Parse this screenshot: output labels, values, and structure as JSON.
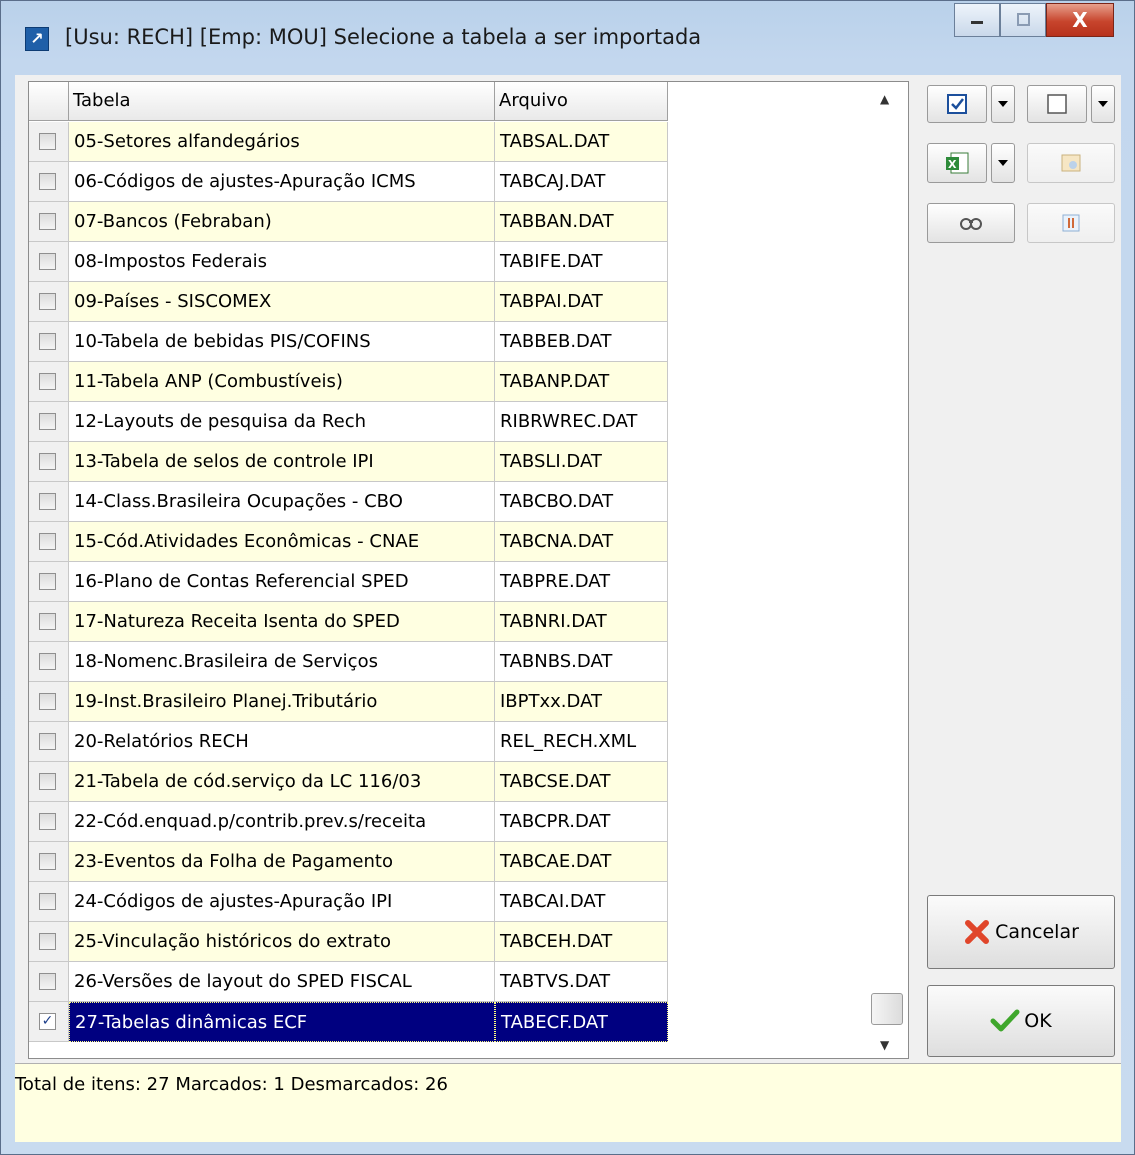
{
  "window": {
    "title": "[Usu: RECH] [Emp: MOU] Selecione a tabela a ser importada",
    "close_glyph": "X"
  },
  "table": {
    "columns": [
      "Tabela",
      "Arquivo"
    ],
    "rows": [
      {
        "checked": false,
        "tabela": "05-Setores alfandegários",
        "arquivo": "TABSAL.DAT"
      },
      {
        "checked": false,
        "tabela": "06-Códigos de ajustes-Apuração ICMS",
        "arquivo": "TABCAJ.DAT"
      },
      {
        "checked": false,
        "tabela": "07-Bancos (Febraban)",
        "arquivo": "TABBAN.DAT"
      },
      {
        "checked": false,
        "tabela": "08-Impostos Federais",
        "arquivo": "TABIFE.DAT"
      },
      {
        "checked": false,
        "tabela": "09-Países - SISCOMEX",
        "arquivo": "TABPAI.DAT"
      },
      {
        "checked": false,
        "tabela": "10-Tabela de bebidas PIS/COFINS",
        "arquivo": "TABBEB.DAT"
      },
      {
        "checked": false,
        "tabela": "11-Tabela ANP (Combustíveis)",
        "arquivo": "TABANP.DAT"
      },
      {
        "checked": false,
        "tabela": "12-Layouts de pesquisa da Rech",
        "arquivo": "RIBRWREC.DAT"
      },
      {
        "checked": false,
        "tabela": "13-Tabela de selos de controle IPI",
        "arquivo": "TABSLI.DAT"
      },
      {
        "checked": false,
        "tabela": "14-Class.Brasileira Ocupações - CBO",
        "arquivo": "TABCBO.DAT"
      },
      {
        "checked": false,
        "tabela": "15-Cód.Atividades Econômicas - CNAE",
        "arquivo": "TABCNA.DAT"
      },
      {
        "checked": false,
        "tabela": "16-Plano de Contas Referencial SPED",
        "arquivo": "TABPRE.DAT"
      },
      {
        "checked": false,
        "tabela": "17-Natureza Receita Isenta do SPED",
        "arquivo": "TABNRI.DAT"
      },
      {
        "checked": false,
        "tabela": "18-Nomenc.Brasileira de Serviços",
        "arquivo": "TABNBS.DAT"
      },
      {
        "checked": false,
        "tabela": "19-Inst.Brasileiro Planej.Tributário",
        "arquivo": "IBPTxx.DAT"
      },
      {
        "checked": false,
        "tabela": "20-Relatórios RECH",
        "arquivo": "REL_RECH.XML"
      },
      {
        "checked": false,
        "tabela": "21-Tabela de cód.serviço da LC 116/03",
        "arquivo": "TABCSE.DAT"
      },
      {
        "checked": false,
        "tabela": "22-Cód.enquad.p/contrib.prev.s/receita",
        "arquivo": "TABCPR.DAT"
      },
      {
        "checked": false,
        "tabela": "23-Eventos da Folha de Pagamento",
        "arquivo": "TABCAE.DAT"
      },
      {
        "checked": false,
        "tabela": "24-Códigos de ajustes-Apuração IPI",
        "arquivo": "TABCAI.DAT"
      },
      {
        "checked": false,
        "tabela": "25-Vinculação históricos do extrato",
        "arquivo": "TABCEH.DAT"
      },
      {
        "checked": false,
        "tabela": "26-Versões de layout do SPED FISCAL",
        "arquivo": "TABTVS.DAT"
      },
      {
        "checked": true,
        "tabela": "27-Tabelas dinâmicas ECF",
        "arquivo": "TABECF.DAT"
      }
    ]
  },
  "status": {
    "text": "Total de itens: 27 Marcados: 1 Desmarcados: 26"
  },
  "buttons": {
    "cancel_label": "Cancelar",
    "ok_label": "OK"
  },
  "icons": {
    "check_all": "checkbox-checked-icon",
    "uncheck_all": "checkbox-empty-icon",
    "excel": "excel-icon",
    "find": "binoculars-icon",
    "cancel": "red-x-icon",
    "ok": "green-check-icon"
  },
  "colors": {
    "selection": "#000080",
    "row_alt": "#ffffe1",
    "status_bg": "#ffffe1"
  }
}
